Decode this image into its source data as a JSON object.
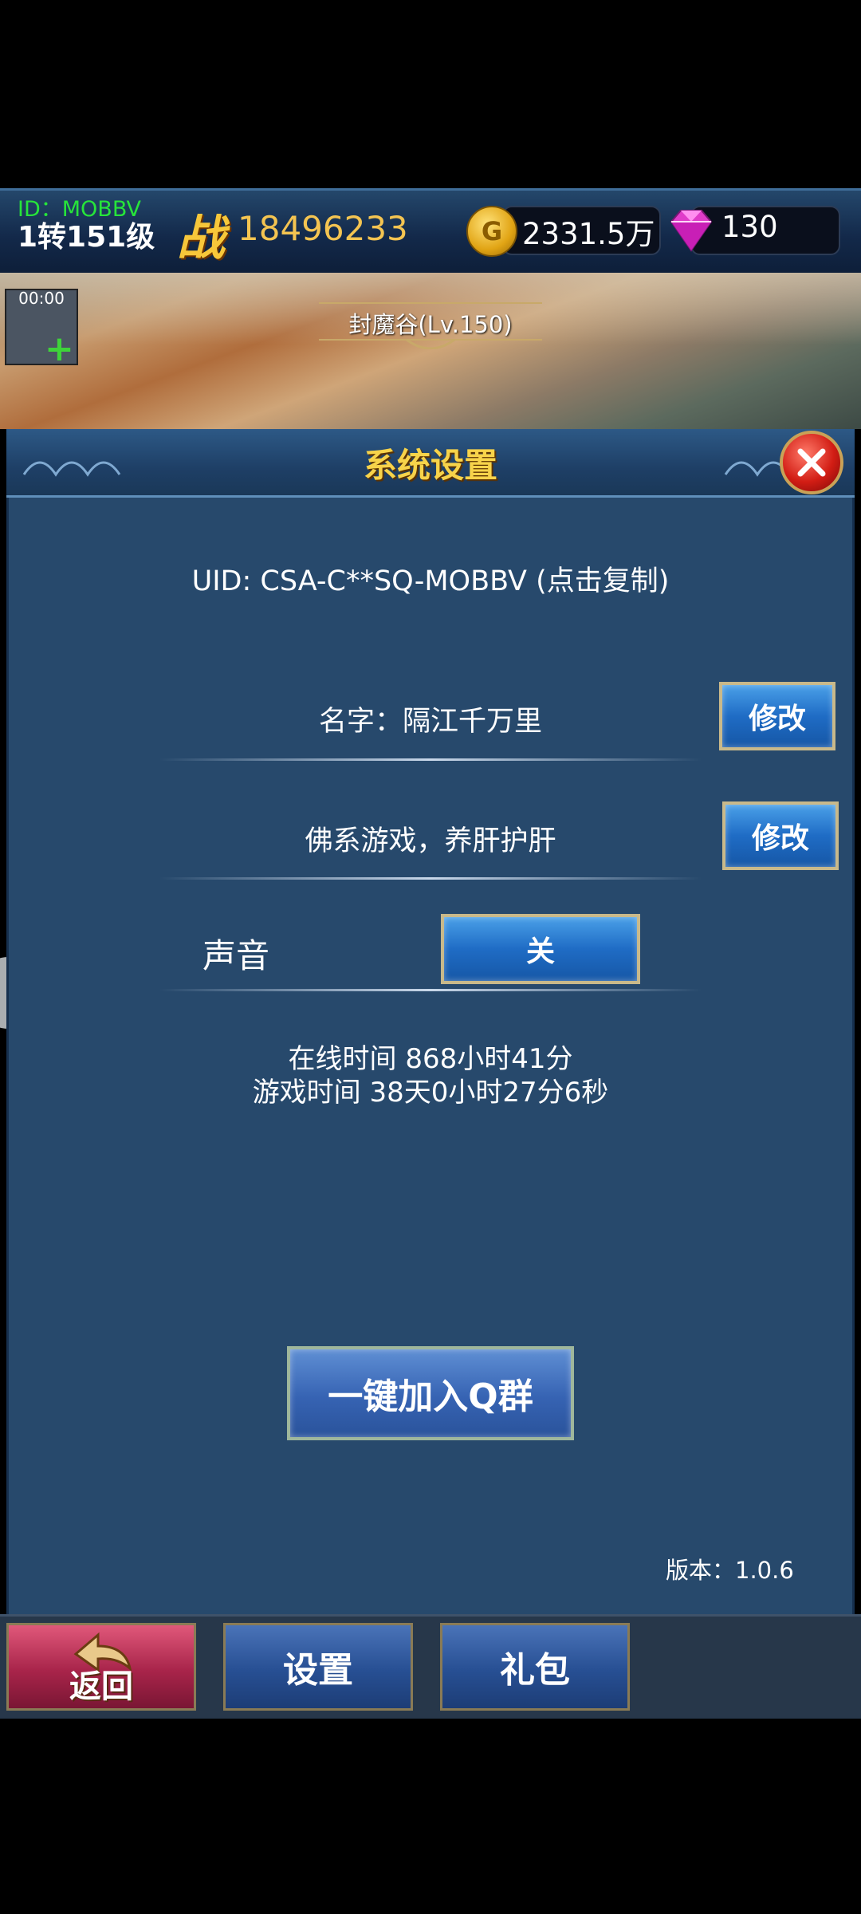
{
  "top_bar": {
    "player_id": "ID：MOBBV",
    "player_level": "1转151级",
    "power_icon_text": "战",
    "power_value": "18496233",
    "gold_value": "2331.5万",
    "gold_icon_letter": "G",
    "gems_value": "130"
  },
  "banner": {
    "timer": "00:00",
    "map_name": "封魔谷(Lv.150)"
  },
  "panel": {
    "title": "系统设置",
    "uid_text": "UID: CSA-C**SQ-MOBBV (点击复制)",
    "name_text": "名字：隔江千万里",
    "motto_text": "佛系游戏，养肝护肝",
    "edit_label": "修改",
    "sound_label": "声音",
    "sound_value": "关",
    "online_time": "在线时间 868小时41分",
    "play_time": "游戏时间 38天0小时27分6秒",
    "join_group_label": "一键加入Q群",
    "version": "版本：1.0.6"
  },
  "bottom_tabs": {
    "back_label": "返回",
    "settings_label": "设置",
    "gift_label": "礼包"
  },
  "colors": {
    "panel_bg": "#27496c",
    "title_gold": "#f7d34a",
    "button_blue": "#1f6cc5",
    "id_green": "#27e43a"
  }
}
